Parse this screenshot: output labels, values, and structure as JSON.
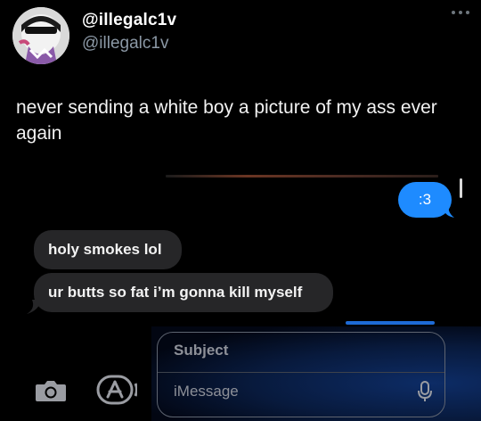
{
  "tweet": {
    "display_name": "@illegalc1v",
    "handle": "@illegalc1v",
    "text": "never sending a white boy a picture of my ass ever again",
    "icons": {
      "avatar": "avatar",
      "more": "more-icon"
    }
  },
  "screenshot": {
    "messages": {
      "sent": ":3",
      "received": [
        "holy smokes lol",
        "ur butts so fat i’m gonna kill myself"
      ]
    },
    "compose": {
      "subject_placeholder": "Subject",
      "message_placeholder": "iMessage",
      "icons": {
        "camera": "camera-icon",
        "app_store": "app-store-icon",
        "mic": "microphone-icon"
      }
    },
    "colors": {
      "sent_bubble": "#1e8bff",
      "received_bubble": "#262628",
      "background": "#000000"
    }
  }
}
